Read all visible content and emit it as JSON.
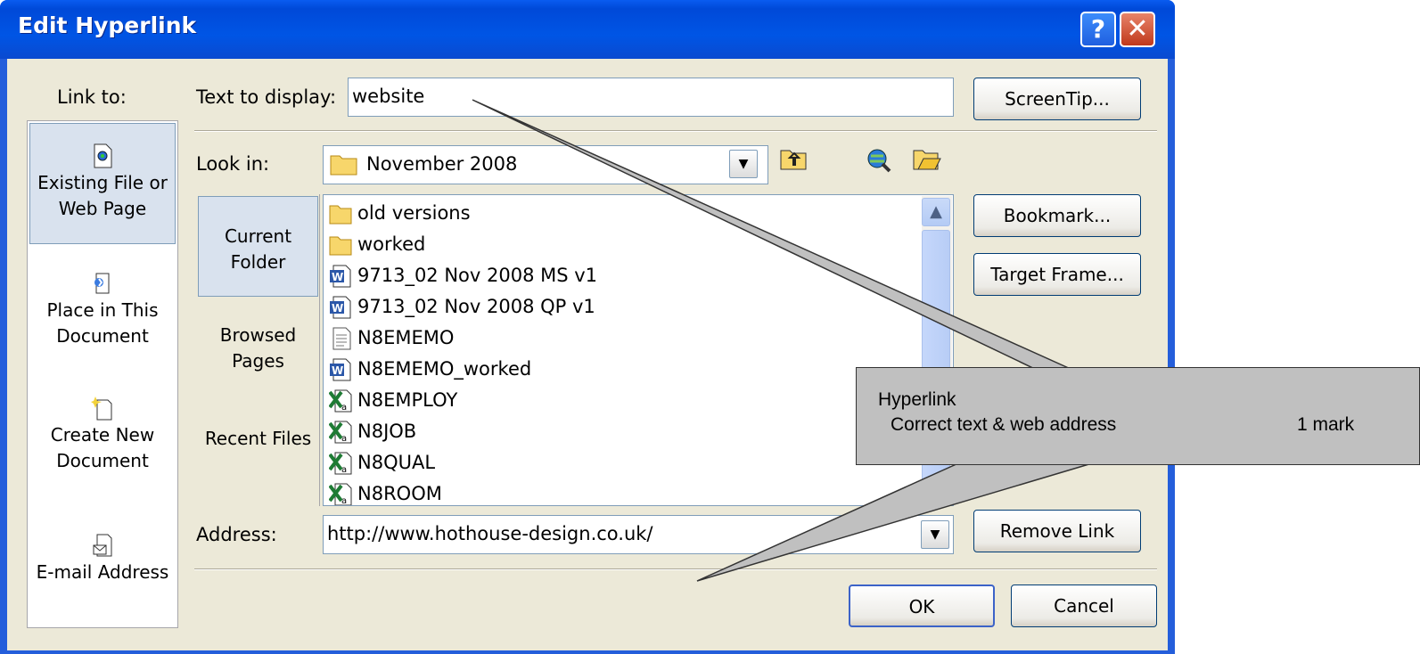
{
  "window": {
    "title": "Edit Hyperlink",
    "help_glyph": "?",
    "close_glyph": "✕"
  },
  "link_to": {
    "label": "Link to:",
    "items": [
      {
        "label": "Existing File or Web Page",
        "icon": "existing-file-icon",
        "selected": true
      },
      {
        "label": "Place in This Document",
        "icon": "place-in-document-icon"
      },
      {
        "label": "Create New Document",
        "icon": "new-document-icon"
      },
      {
        "label": "E-mail Address",
        "icon": "email-icon"
      }
    ]
  },
  "text_to_display": {
    "label": "Text to display:",
    "value": "website"
  },
  "screentip_button": "ScreenTip...",
  "look_in": {
    "label": "Look in:",
    "value": "November 2008"
  },
  "folder_views": [
    {
      "label": "Current Folder",
      "selected": true
    },
    {
      "label": "Browsed Pages"
    },
    {
      "label": "Recent Files"
    }
  ],
  "files": [
    {
      "name": "old versions",
      "icon": "folder-icon"
    },
    {
      "name": "worked",
      "icon": "folder-icon"
    },
    {
      "name": "9713_02 Nov 2008 MS v1",
      "icon": "word-doc-icon"
    },
    {
      "name": "9713_02 Nov 2008 QP v1",
      "icon": "word-doc-icon"
    },
    {
      "name": "N8EMEMO",
      "icon": "text-file-icon"
    },
    {
      "name": "N8EMEMO_worked",
      "icon": "word-doc-icon"
    },
    {
      "name": "N8EMPLOY",
      "icon": "excel-file-icon"
    },
    {
      "name": "N8JOB",
      "icon": "excel-file-icon"
    },
    {
      "name": "N8QUAL",
      "icon": "excel-file-icon"
    },
    {
      "name": "N8ROOM",
      "icon": "excel-file-icon"
    }
  ],
  "right_buttons": {
    "bookmark": "Bookmark...",
    "target_frame": "Target Frame...",
    "remove_link": "Remove Link"
  },
  "address": {
    "label": "Address:",
    "value": "http://www.hothouse-design.co.uk/"
  },
  "footer": {
    "ok": "OK",
    "cancel": "Cancel"
  },
  "annotation": {
    "heading": "Hyperlink",
    "criterion": "Correct text & web address",
    "marks": "1 mark"
  },
  "colors": {
    "titlebar": "#0055e5",
    "dialog_bg": "#ece9d8",
    "callout": "#c0c0c0"
  }
}
